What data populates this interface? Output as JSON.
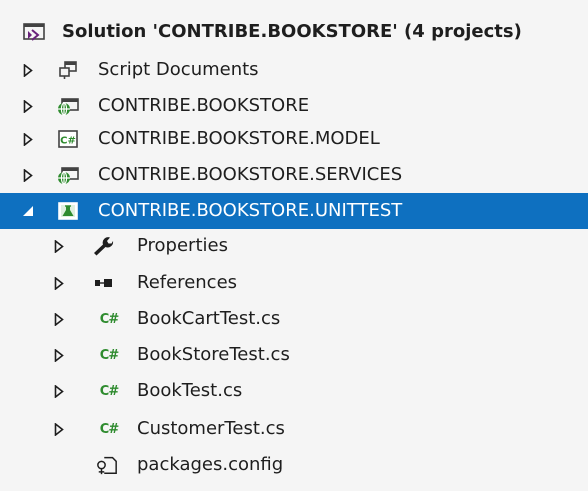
{
  "solution": {
    "label": "Solution 'CONTRIBE.BOOKSTORE' (4 projects)"
  },
  "items": [
    {
      "label": "Script Documents",
      "icon": "script-documents-icon"
    },
    {
      "label": "CONTRIBE.BOOKSTORE",
      "icon": "web-project-icon"
    },
    {
      "label": "CONTRIBE.BOOKSTORE.MODEL",
      "icon": "csharp-project-icon"
    },
    {
      "label": "CONTRIBE.BOOKSTORE.SERVICES",
      "icon": "web-project-icon"
    },
    {
      "label": "CONTRIBE.BOOKSTORE.UNITTEST",
      "icon": "test-project-icon",
      "selected": true
    },
    {
      "label": "Properties",
      "icon": "wrench-icon"
    },
    {
      "label": "References",
      "icon": "references-icon"
    },
    {
      "label": "BookCartTest.cs",
      "icon": "csharp-file-icon"
    },
    {
      "label": "BookStoreTest.cs",
      "icon": "csharp-file-icon"
    },
    {
      "label": "BookTest.cs",
      "icon": "csharp-file-icon"
    },
    {
      "label": "CustomerTest.cs",
      "icon": "csharp-file-icon"
    },
    {
      "label": "packages.config",
      "icon": "config-file-icon"
    }
  ],
  "colors": {
    "background": "#f5f5f5",
    "selection": "#0e70c0",
    "csharp_green": "#2e8b2e",
    "vs_purple": "#68217a"
  }
}
